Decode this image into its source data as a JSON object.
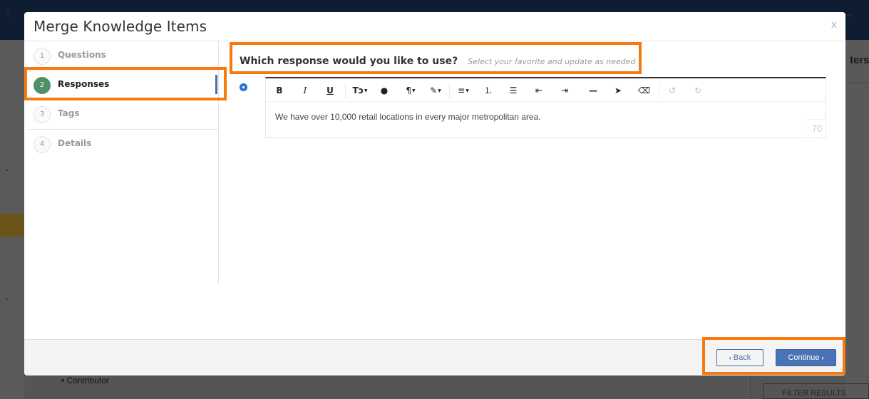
{
  "modal": {
    "title": "Merge Knowledge Items",
    "close_label": "x"
  },
  "steps": [
    {
      "number": "1",
      "label": "Questions"
    },
    {
      "number": "2",
      "label": "Responses"
    },
    {
      "number": "3",
      "label": "Tags"
    },
    {
      "number": "4",
      "label": "Details"
    }
  ],
  "active_step": 2,
  "prompt": {
    "title": "Which response would you like to use?",
    "subtitle": "Select your favorite and update as needed"
  },
  "editor": {
    "toolbar_icons": [
      "bold-icon",
      "italic-icon",
      "underline-icon",
      "font-size-icon",
      "color-icon",
      "paragraph-icon",
      "magic-style-icon",
      "align-icon",
      "ordered-list-icon",
      "unordered-list-icon",
      "outdent-icon",
      "indent-icon",
      "horizontal-rule-icon",
      "select-pointer-icon",
      "eraser-icon",
      "undo-icon",
      "redo-icon"
    ],
    "content": "We have over 10,000 retail locations in every major metropolitan area.",
    "char_count": "70"
  },
  "footer": {
    "back_label": "Back",
    "continue_label": "Continue"
  },
  "background": {
    "right_panel_text": "ters",
    "list_item": "Contributor",
    "filter_button": "FILTER RESULTS"
  },
  "colors": {
    "highlight": "#f57a10",
    "active_step": "#4f8f6a",
    "primary_button": "#4a73b5",
    "radio_selected": "#2b7bd9"
  }
}
